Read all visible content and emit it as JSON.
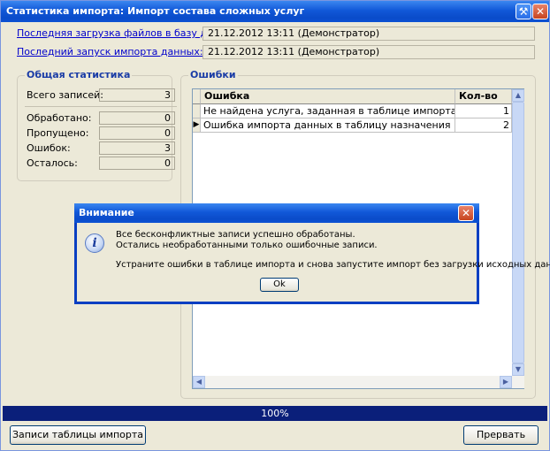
{
  "window": {
    "title": "Статистика импорта: Импорт состава сложных услуг"
  },
  "info": {
    "last_upload_label": "Последняя загрузка файлов в базу данных:",
    "last_upload_value": "21.12.2012 13:11 (Демонстратор)",
    "last_import_label": "Последний запуск импорта данных:",
    "last_import_value": "21.12.2012 13:11 (Демонстратор)"
  },
  "stats": {
    "group_title": "Общая статистика",
    "rows": [
      {
        "label": "Всего записей:",
        "value": "3"
      },
      {
        "label": "Обработано:",
        "value": "0"
      },
      {
        "label": "Пропущено:",
        "value": "0"
      },
      {
        "label": "Ошибок:",
        "value": "3"
      },
      {
        "label": "Осталось:",
        "value": "0"
      }
    ]
  },
  "errors": {
    "group_title": "Ошибки",
    "columns": [
      "Ошибка",
      "Кол-во"
    ],
    "rows": [
      {
        "error": "Не найдена услуга, заданная в таблице импорта",
        "count": "1"
      },
      {
        "error": "Ошибка импорта данных в таблицу назначения",
        "count": "2"
      }
    ]
  },
  "progress": {
    "text": "100%",
    "fraction": 1.0
  },
  "buttons": {
    "records": "Записи таблицы импорта",
    "abort": "Прервать"
  },
  "dialog": {
    "title": "Внимание",
    "lines": [
      "Все бесконфликтные записи успешно обработаны.",
      "Остались необработанными только ошибочные записи.",
      "Устраните ошибки в таблице импорта и снова запустите импорт без загрузки исходных данных."
    ],
    "ok": "Ok"
  },
  "colors": {
    "titlebar": "#0a4bc9",
    "link": "#0000cc",
    "progress": "#0a1f7a",
    "group_title": "#1a3ca6"
  },
  "icons": [
    "wrench-icon",
    "close-icon",
    "info-icon",
    "row-pointer-icon",
    "scroll-up-icon",
    "scroll-down-icon",
    "scroll-left-icon",
    "scroll-right-icon"
  ]
}
